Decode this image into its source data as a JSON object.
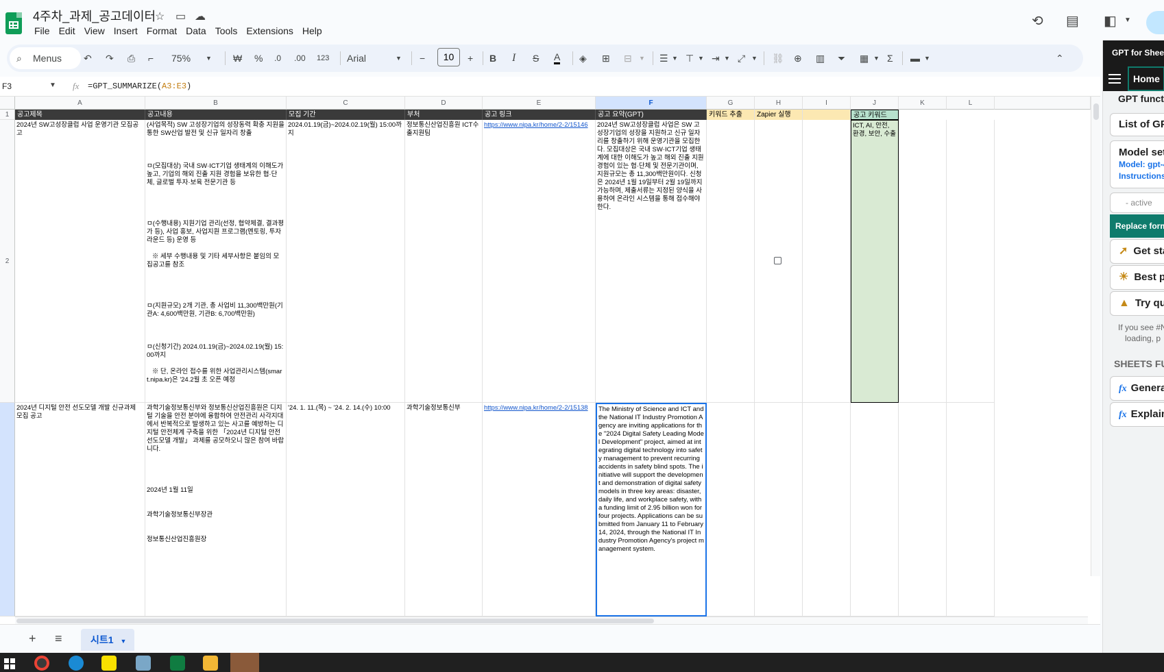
{
  "app": {
    "doc_title": "4주차_과제_공고데이터",
    "menu": [
      "File",
      "Edit",
      "View",
      "Insert",
      "Format",
      "Data",
      "Tools",
      "Extensions",
      "Help"
    ]
  },
  "toolbar": {
    "menus_label": "Menus",
    "zoom": "75%",
    "currency": "₩",
    "percent": "%",
    "dec_decrease": ".0",
    "dec_increase": ".00",
    "number_format": "123",
    "font": "Arial",
    "font_size": "10",
    "bold": "B",
    "italic": "I",
    "strike": "S",
    "text_color": "A"
  },
  "formula_bar": {
    "cell_ref": "F3",
    "fx": "fx",
    "formula_prefix": "=GPT_SUMMARIZE(",
    "formula_range": "A3:E3",
    "formula_suffix": ")"
  },
  "grid": {
    "columns": [
      "A",
      "B",
      "C",
      "D",
      "E",
      "F",
      "G",
      "H",
      "I",
      "J",
      "K",
      "L"
    ],
    "rows": [
      "1",
      "2",
      "3"
    ],
    "headers": {
      "A": "공고제목",
      "B": "공고내용",
      "C": "모집 기간",
      "D": "부처",
      "E": "공고 링크",
      "F": "공고 요약(GPT)",
      "G": "키워드 추출",
      "H": "Zapier 실행",
      "J": "공고 키워드"
    },
    "row2": {
      "A": "2024년 SW고성장클럽 사업 운영기관 모집공고",
      "B": "(사업목적) SW 고성장기업의 성장동력 확충 지원을 통한 SW산업 발전 및 신규 일자리 창출\n\n\n\nㅁ(모집대상) 국내 SW·ICT기업 생태계의 이해도가 높고, 기업의 해외 진출 지원 경험을 보유한 협·단체, 글로벌 투자·보육 전문기관 등\n\n\n\n\nㅁ(수행내용) 지원기업 관리(선정, 협약체결, 결과평가 등), 사업 홍보, 사업지원 프로그램(멘토링, 투자라운드 등) 운영 등\n\n   ※ 세부 수행내용 및 기타 세부사항은 붙임의 모집공고를 참조\n\n\n\n\nㅁ(지원규모) 2개 기관, 총 사업비 11,300백만원(기관A: 4,600백만원, 기관B: 6,700백만원)\n\n\n\nㅁ(신청기간) 2024.01.19(금)~2024.02.19(월) 15:00까지\n\n   ※ 단, 온라인 접수를 위한 사업관리시스템(smart.nipa.kr)은 '24.2월 초 오픈 예정\n\n\n\nㅁ(신청방법) 제출서류(수행계획서 등)는 첨부된 양식을 활용하여 작성, 사업관리시스템(smart.nipa.kr) 접수",
      "C": "2024.01.19(금)~2024.02.19(월) 15:00까지",
      "D": "정보통신산업진흥원 ICT수출지원팀",
      "E": "https://www.nipa.kr/home/2-2/15146",
      "F": "2024년 SW고성장클럽 사업은 SW 고성장기업의 성장을 지원하고 신규 일자리를 창출하기 위해 운영기관을 모집한다. 모집대상은 국내 SW·ICT기업 생태계에 대한 이해도가 높고 해외 진출 지원 경험이 있는 협·단체 및 전문기관이며, 지원규모는 총 11,300백만원이다. 신청은 2024년 1월 19일부터 2월 19일까지 가능하며, 제출서류는 지정된 양식을 사용하여 온라인 시스템을 통해 접수해야 한다.",
      "J": "ICT, AI, 안전, 환경, 보안, 수출"
    },
    "row3": {
      "A": "2024년 디지털 안전 선도모델 개발 신규과제 모집 공고",
      "B": "과학기술정보통신부와 정보통신산업진흥원은 디지털 기술을 안전 분야에 융합하여 안전관리 사각지대에서 반복적으로 발생하고 있는 사고를 예방하는 디지털 안전체계 구축을 위한 「2024년 디지털 안전 선도모델 개발」 과제를 공모하오니 많은 참여 바랍니다.\n\n\n\n\n2024년 1월 11일\n\n\n과학기술정보통신부장관\n\n\n정보통신산업진흥원장",
      "C": "'24. 1. 11.(목) ~ '24. 2. 14.(수) 10:00",
      "D": "과학기술정보통신부",
      "E": "https://www.nipa.kr/home/2-2/15138",
      "F": "The Ministry of Science and ICT and the National IT Industry Promotion Agency are inviting applications for the \"2024 Digital Safety Leading Model Development\" project, aimed at integrating digital technology into safety management to prevent recurring accidents in safety blind spots. The initiative will support the development and demonstration of digital safety models in three key areas: disaster, daily life, and workplace safety, with a funding limit of 2.95 billion won for four projects. Applications can be submitted from January 11 to February 14, 2024, through the National IT Industry Promotion Agency's project management system."
    }
  },
  "sheets": {
    "active_tab": "시트1"
  },
  "sidebar": {
    "title": "GPT for Sheets",
    "home": "Home",
    "section_title": "GPT functions",
    "list_label": "List of GPT functions",
    "model_title": "Model settings",
    "model_value": "Model: gpt-4",
    "instructions": "Instructions",
    "active": "- active",
    "replace_btn": "Replace formulas",
    "get_started": "Get started",
    "best_practices": "Best practices",
    "try_quick": "Try quick",
    "note_line1": "If you see #NAME",
    "note_line2": "loading, p",
    "sheets_section": "SHEETS FUNCTIONS",
    "generate": "Generate",
    "explain": "Explain"
  },
  "colors": {
    "accent": "#1a73e8",
    "header_dark": "#3a3a3a",
    "gpt_header": "#fce8b2",
    "keyword_fill": "#b7e1cd",
    "sidebar_green": "#0f7b6c"
  }
}
